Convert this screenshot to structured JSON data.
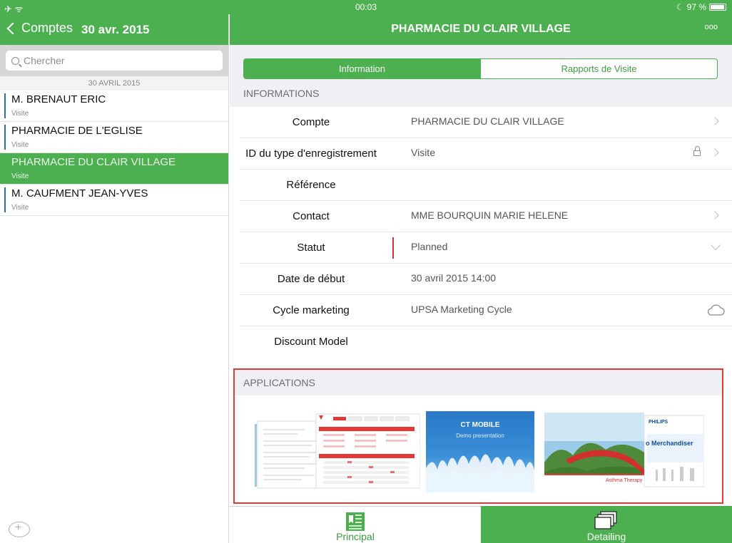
{
  "status_bar": {
    "left_icons": "✈ ᯤ",
    "time": "00:03",
    "battery": "97 %"
  },
  "left": {
    "back_label": "Comptes",
    "date": "30 avr. 2015",
    "search_placeholder": "Chercher",
    "section_header": "30 AVRIL 2015",
    "items": [
      {
        "title": "M. BRENAUT ERIC",
        "subtitle": "Visite",
        "selected": false
      },
      {
        "title": "PHARMACIE DE L'EGLISE",
        "subtitle": "Visite",
        "selected": false
      },
      {
        "title": "PHARMACIE DU CLAIR VILLAGE",
        "subtitle": "Visite",
        "selected": true
      },
      {
        "title": "M. CAUFMENT JEAN-YVES",
        "subtitle": "Visite",
        "selected": false
      }
    ]
  },
  "right": {
    "title": "PHARMACIE DU CLAIR VILLAGE",
    "more_label": "ooo",
    "segments": {
      "information": "Information",
      "rapports": "Rapports de Visite"
    },
    "group_informations": "INFORMATIONS",
    "fields": [
      {
        "label": "Compte",
        "value": "PHARMACIE DU CLAIR VILLAGE"
      },
      {
        "label": "ID du type d'enregistrement",
        "value": "Visite"
      },
      {
        "label": "Référence",
        "value": ""
      },
      {
        "label": "Contact",
        "value": "MME BOURQUIN MARIE HELENE"
      },
      {
        "label": "Statut",
        "value": "Planned"
      },
      {
        "label": "Date de début",
        "value": "30 avril 2015 14:00"
      },
      {
        "label": "Cycle marketing",
        "value": "UPSA Marketing Cycle"
      },
      {
        "label": "Discount Model",
        "value": ""
      }
    ],
    "group_applications": "APPLICATIONS",
    "thumbnails": {
      "ct_brand": "CT MOBILE",
      "ct_caption": "Demo presentation",
      "philips_brand": "PHILIPS",
      "philips_caption": "o Merchandiser",
      "asthma_caption": "Asthma Therapy"
    },
    "tabs": {
      "principal": "Principal",
      "detailing": "Detailing"
    }
  },
  "colors": {
    "brand_green": "#4caf50",
    "highlight_red": "#e53935"
  }
}
